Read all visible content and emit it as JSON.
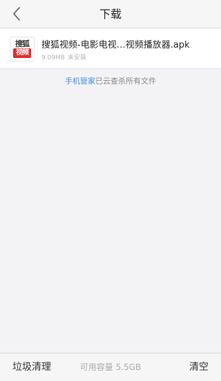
{
  "header": {
    "title": "下载",
    "back_icon": "chevron-left-icon"
  },
  "downloads": [
    {
      "name": "搜狐视频-电影电视…视频播放器.apk",
      "size": "9.09MB",
      "status": "未安装",
      "icon": {
        "name": "sohu-video-icon",
        "top_text": "搜狐",
        "bottom_text": "视频",
        "accent": "#e42a2a"
      }
    }
  ],
  "scan_note": {
    "brand": "手机管家",
    "text": "已云查杀所有文件",
    "brand_color": "#3d8fe0"
  },
  "footer": {
    "junk_label": "垃圾清理",
    "storage_text": "可用容量 5.5GB",
    "clear_label": "清空"
  }
}
